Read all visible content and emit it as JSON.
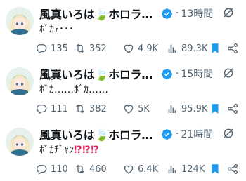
{
  "tweets": [
    {
      "author": "風真いろは🍃ホロライ…",
      "time": "13時間",
      "text": "ﾎﾞｶｧ･･･",
      "text_excl": "",
      "replies": "135",
      "reposts": "352",
      "likes": "4.9K",
      "views": "89.3K"
    },
    {
      "author": "風真いろは🍃ホロライ…",
      "time": "15時間",
      "text": "ﾎﾞｶ……ﾎﾞｶ……",
      "text_excl": "",
      "replies": "111",
      "reposts": "382",
      "likes": "5K",
      "views": "95.9K"
    },
    {
      "author": "風真いろは🍃ホロライ…",
      "time": "21時間",
      "text": "ﾎﾞｶﾁﾞｬﾝ",
      "text_excl": "⁉⁉⁉",
      "replies": "110",
      "reposts": "460",
      "likes": "6.4K",
      "views": "124K"
    }
  ],
  "separator": "·",
  "colors": {
    "verified": "#1d9bf0",
    "bookmark": "#1d9bf0",
    "muted": "#536471",
    "exclaim": "#e0245e"
  },
  "icons": [
    "verified-badge-icon",
    "grok-icon",
    "reply-icon",
    "repost-icon",
    "like-icon",
    "views-icon",
    "bookmark-icon",
    "share-icon"
  ]
}
